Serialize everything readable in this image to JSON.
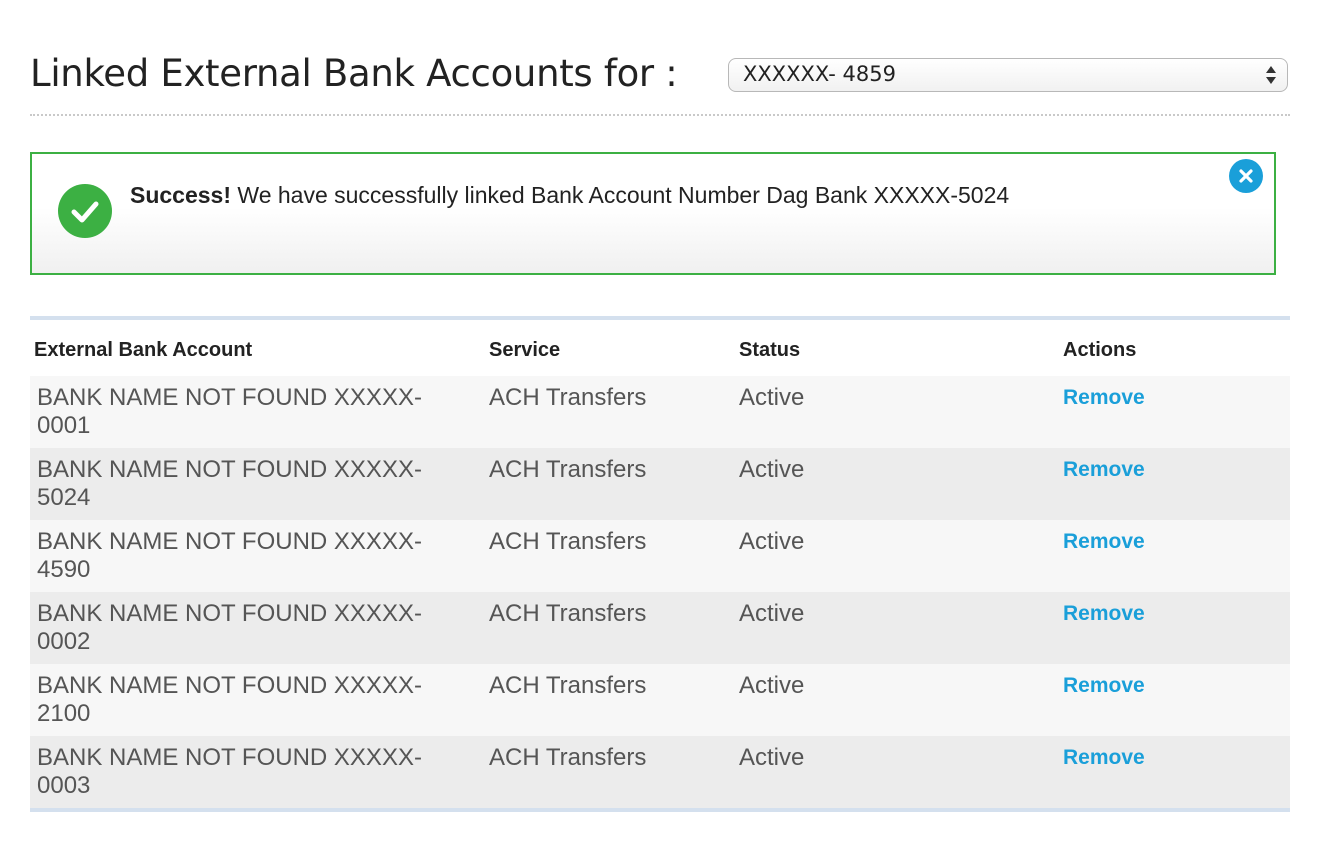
{
  "header": {
    "title": "Linked External Bank Accounts for :",
    "account_select": {
      "value": "XXXXXX- 4859"
    }
  },
  "alert": {
    "strong": "Success!",
    "message": " We have successfully linked Bank Account Number Dag Bank XXXXX-5024",
    "colors": {
      "border": "#3cb043",
      "check": "#3cb043",
      "close": "#1a9fd9"
    }
  },
  "table": {
    "headers": {
      "account": "External Bank Account",
      "service": "Service",
      "status": "Status",
      "actions": "Actions"
    },
    "rows": [
      {
        "account": "BANK NAME NOT FOUND XXXXX-0001",
        "service": "ACH Transfers",
        "status": "Active",
        "action": "Remove"
      },
      {
        "account": "BANK NAME NOT FOUND XXXXX-5024",
        "service": "ACH Transfers",
        "status": "Active",
        "action": "Remove"
      },
      {
        "account": "BANK NAME NOT FOUND XXXXX-4590",
        "service": "ACH Transfers",
        "status": "Active",
        "action": "Remove"
      },
      {
        "account": "BANK NAME NOT FOUND XXXXX-0002",
        "service": "ACH Transfers",
        "status": "Active",
        "action": "Remove"
      },
      {
        "account": "BANK NAME NOT FOUND XXXXX-2100",
        "service": "ACH Transfers",
        "status": "Active",
        "action": "Remove"
      },
      {
        "account": "BANK NAME NOT FOUND XXXXX-0003",
        "service": "ACH Transfers",
        "status": "Active",
        "action": "Remove"
      }
    ]
  },
  "icons": {
    "success": "check-circle-icon",
    "close": "close-icon",
    "select": "select-arrows-icon"
  },
  "colors": {
    "link": "#1a9fd9",
    "table_rule": "#d4e0ee"
  }
}
